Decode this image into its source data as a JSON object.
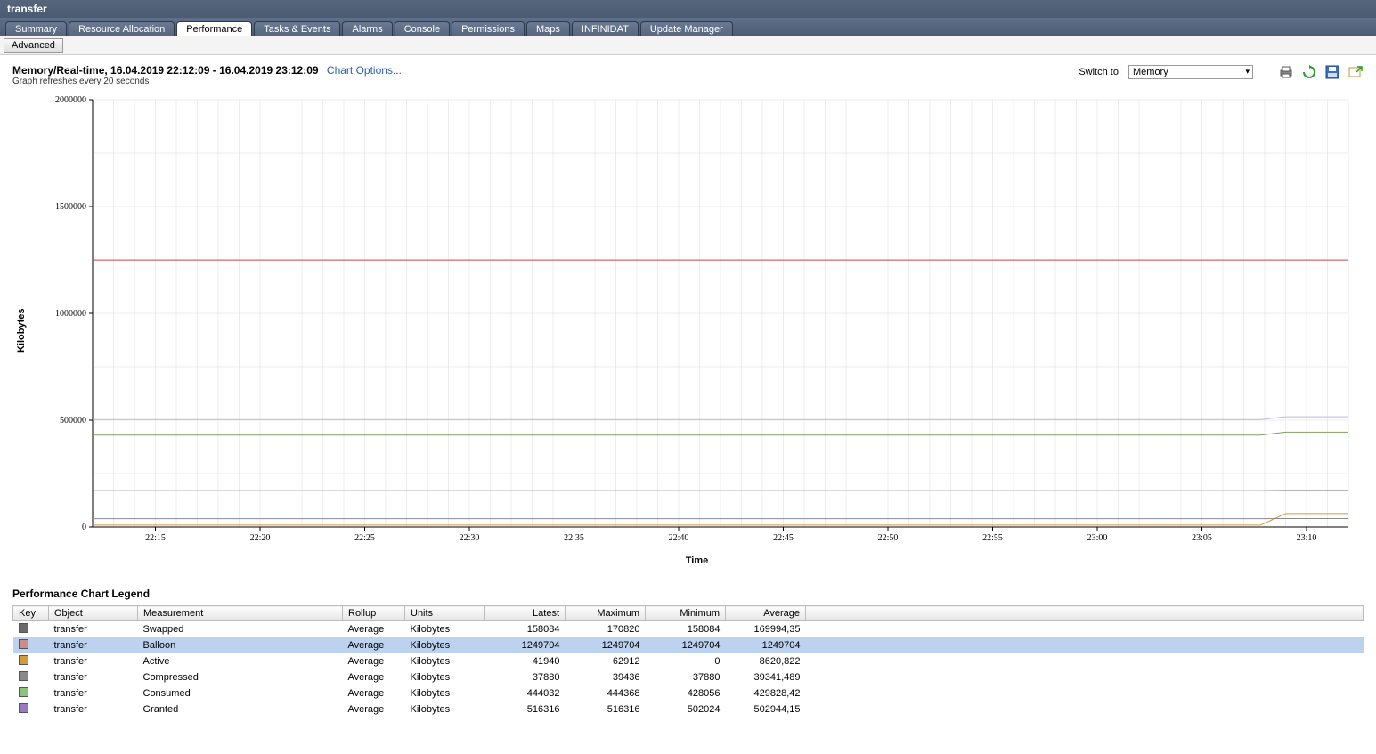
{
  "window_title": "transfer",
  "tabs": {
    "items": [
      {
        "label": "Summary",
        "active": false
      },
      {
        "label": "Resource Allocation",
        "active": false
      },
      {
        "label": "Performance",
        "active": true
      },
      {
        "label": "Tasks & Events",
        "active": false
      },
      {
        "label": "Alarms",
        "active": false
      },
      {
        "label": "Console",
        "active": false
      },
      {
        "label": "Permissions",
        "active": false
      },
      {
        "label": "Maps",
        "active": false
      },
      {
        "label": "INFINIDAT",
        "active": false
      },
      {
        "label": "Update Manager",
        "active": false
      }
    ]
  },
  "sub_button": "Advanced",
  "header": {
    "title": "Memory/Real-time, 16.04.2019 22:12:09 - 16.04.2019 23:12:09",
    "chart_options_label": "Chart Options...",
    "refresh_note": "Graph refreshes every 20 seconds"
  },
  "switch_to_label": "Switch to:",
  "switch_to_value": "Memory",
  "chart": {
    "ylabel": "Kilobytes",
    "xlabel": "Time"
  },
  "legend_title": "Performance Chart Legend",
  "legend_headers": [
    "Key",
    "Object",
    "Measurement",
    "Rollup",
    "Units",
    "Latest",
    "Maximum",
    "Minimum",
    "Average"
  ],
  "legend_rows": [
    {
      "color": "#6a6a6a",
      "object": "transfer",
      "measurement": "Swapped",
      "rollup": "Average",
      "units": "Kilobytes",
      "latest": "158084",
      "maximum": "170820",
      "minimum": "158084",
      "average": "169994,35",
      "selected": false
    },
    {
      "color": "#cc8c8c",
      "object": "transfer",
      "measurement": "Balloon",
      "rollup": "Average",
      "units": "Kilobytes",
      "latest": "1249704",
      "maximum": "1249704",
      "minimum": "1249704",
      "average": "1249704",
      "selected": true
    },
    {
      "color": "#d59a3a",
      "object": "transfer",
      "measurement": "Active",
      "rollup": "Average",
      "units": "Kilobytes",
      "latest": "41940",
      "maximum": "62912",
      "minimum": "0",
      "average": "8620,822",
      "selected": false
    },
    {
      "color": "#8a8a8a",
      "object": "transfer",
      "measurement": "Compressed",
      "rollup": "Average",
      "units": "Kilobytes",
      "latest": "37880",
      "maximum": "39436",
      "minimum": "37880",
      "average": "39341,489",
      "selected": false
    },
    {
      "color": "#89c479",
      "object": "transfer",
      "measurement": "Consumed",
      "rollup": "Average",
      "units": "Kilobytes",
      "latest": "444032",
      "maximum": "444368",
      "minimum": "428056",
      "average": "429828,42",
      "selected": false
    },
    {
      "color": "#9a7abf",
      "object": "transfer",
      "measurement": "Granted",
      "rollup": "Average",
      "units": "Kilobytes",
      "latest": "516316",
      "maximum": "516316",
      "minimum": "502024",
      "average": "502944,15",
      "selected": false
    }
  ],
  "chart_data": {
    "type": "line",
    "title": "Memory/Real-time",
    "xlabel": "Time",
    "ylabel": "Kilobytes",
    "ylim": [
      0,
      2000000
    ],
    "y_ticks": [
      0,
      500000,
      1000000,
      1500000,
      2000000
    ],
    "x_ticks": [
      "22:15",
      "22:20",
      "22:25",
      "22:30",
      "22:35",
      "22:40",
      "22:45",
      "22:50",
      "22:55",
      "23:00",
      "23:05",
      "23:10"
    ],
    "x_range": [
      "22:12:09",
      "23:12:09"
    ],
    "series": [
      {
        "name": "Swapped",
        "color": "#6a6a6a",
        "approx_value": 170000,
        "min": 158084,
        "max": 170820
      },
      {
        "name": "Balloon",
        "color": "#cc4444",
        "approx_value": 1249704,
        "min": 1249704,
        "max": 1249704
      },
      {
        "name": "Active",
        "color": "#d59a3a",
        "approx_value": 9000,
        "min": 0,
        "max": 62912
      },
      {
        "name": "Compressed",
        "color": "#8a8a8a",
        "approx_value": 39000,
        "min": 37880,
        "max": 39436
      },
      {
        "name": "Consumed",
        "color": "#7fa060",
        "approx_value": 430000,
        "min": 428056,
        "max": 444368
      },
      {
        "name": "Granted",
        "color": "#b9b9e6",
        "approx_value": 503000,
        "min": 502024,
        "max": 516316
      }
    ]
  }
}
